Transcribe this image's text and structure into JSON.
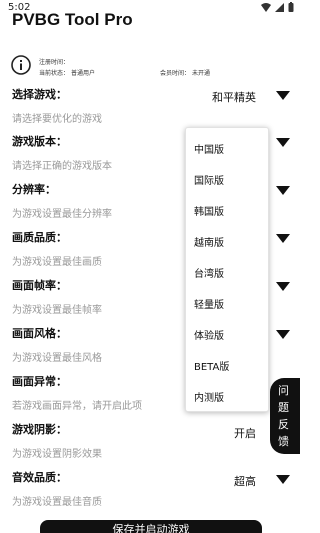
{
  "status_bar": {
    "time": "5:02"
  },
  "app": {
    "title": "PVBG Tool Pro"
  },
  "info": {
    "register_time_label": "注册时间：",
    "current_status_label": "当前状态：",
    "current_status_value": "普通用户",
    "member_time_label": "会员时间：",
    "member_time_value": "未开通"
  },
  "settings": [
    {
      "label": "选择游戏：",
      "desc": "请选择要优化的游戏",
      "value": "和平精英"
    },
    {
      "label": "游戏版本：",
      "desc": "请选择正确的游戏版本",
      "value": ""
    },
    {
      "label": "分辨率：",
      "desc": "为游戏设置最佳分辨率",
      "value": ""
    },
    {
      "label": "画质品质：",
      "desc": "为游戏设置最佳画质",
      "value": ""
    },
    {
      "label": "画面帧率：",
      "desc": "为游戏设置最佳帧率",
      "value": ""
    },
    {
      "label": "画面风格：",
      "desc": "为游戏设置最佳风格",
      "value": ""
    },
    {
      "label": "画面异常：",
      "desc": "若游戏画面异常，请开启此项",
      "value": ""
    },
    {
      "label": "游戏阴影：",
      "desc": "为游戏设置阴影效果",
      "value": "开启"
    },
    {
      "label": "音效品质：",
      "desc": "为游戏设置最佳音质",
      "value": "超高"
    }
  ],
  "dropdown": {
    "options": [
      "中国版",
      "国际版",
      "韩国版",
      "越南版",
      "台湾版",
      "轻量版",
      "体验版",
      "BETA版",
      "内测版"
    ]
  },
  "feedback_tab": {
    "chars": [
      "问",
      "题",
      "反",
      "馈"
    ]
  },
  "bottom_button": {
    "label": "保存并启动游戏"
  }
}
